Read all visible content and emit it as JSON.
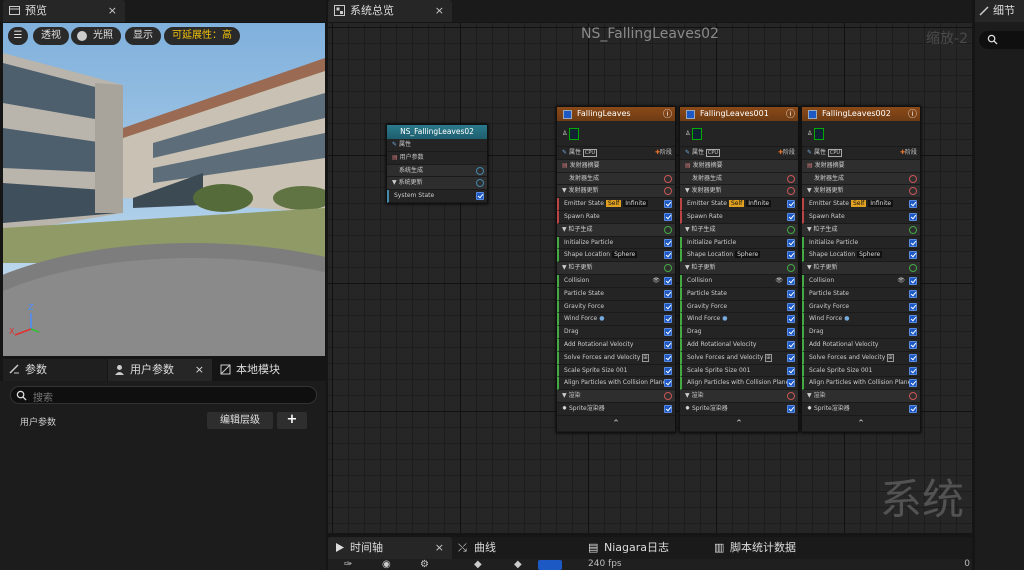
{
  "preview": {
    "tab": "预览",
    "close": "×",
    "buttons": {
      "menu": "☰",
      "perspective": "透视",
      "lighting": "光照",
      "show": "显示",
      "scalability": "可延展性：高"
    },
    "axes": {
      "z": "Z",
      "x": "X"
    }
  },
  "params_panel": {
    "tabs": [
      {
        "label": "参数"
      },
      {
        "label": "用户参数",
        "close": "×"
      },
      {
        "label": "本地模块"
      }
    ],
    "search_placeholder": "搜索",
    "row_label": "用户参数",
    "edit_hierarchy": "编辑层级",
    "add": "+"
  },
  "system_overview": {
    "tab": "系统总览",
    "close": "×",
    "title": "NS_FallingLeaves02",
    "zoom": "缩放-2",
    "watermark": "系统"
  },
  "system_node": {
    "title": "NS_FallingLeaves02",
    "rows": [
      "属性",
      "用户参数",
      "系统生成",
      "系统更新",
      "System State"
    ]
  },
  "emitters": [
    {
      "title": "FallingLeaves",
      "props": "属性",
      "cpu": "CPU",
      "stage": "阶段",
      "rows": [
        "发射器摘要",
        "发射器生成",
        "发射器更新",
        "Emitter State",
        "Spawn Rate",
        "粒子生成",
        "Initialize Particle",
        "Shape Location",
        "粒子更新",
        "Collision",
        "Particle State",
        "Gravity Force",
        "Wind Force",
        "Drag",
        "Add Rotational Velocity",
        "Solve Forces and Velocity",
        "Scale Sprite Size 001",
        "Align Particles with Collision Plane",
        "渲染",
        "Sprite渲染器"
      ],
      "self": "Self",
      "infinite": "Infinite",
      "sphere": "Sphere"
    },
    {
      "title": "FallingLeaves001",
      "props": "属性",
      "cpu": "CPU",
      "stage": "阶段",
      "rows": [
        "发射器摘要",
        "发射器生成",
        "发射器更新",
        "Emitter State",
        "Spawn Rate",
        "粒子生成",
        "Initialize Particle",
        "Shape Location",
        "粒子更新",
        "Collision",
        "Particle State",
        "Gravity Force",
        "Wind Force",
        "Drag",
        "Add Rotational Velocity",
        "Solve Forces and Velocity",
        "Scale Sprite Size 001",
        "Align Particles with Collision Plane",
        "渲染",
        "Sprite渲染器"
      ],
      "self": "Self",
      "infinite": "Infinite",
      "sphere": "Sphere"
    },
    {
      "title": "FallingLeaves002",
      "props": "属性",
      "cpu": "CPU",
      "stage": "阶段",
      "rows": [
        "发射器摘要",
        "发射器生成",
        "发射器更新",
        "Emitter State",
        "Spawn Rate",
        "粒子生成",
        "Initialize Particle",
        "Shape Location",
        "粒子更新",
        "Collision",
        "Particle State",
        "Gravity Force",
        "Wind Force",
        "Drag",
        "Add Rotational Velocity",
        "Solve Forces and Velocity",
        "Scale Sprite Size 001",
        "Align Particles with Collision Plane",
        "渲染",
        "Sprite渲染器"
      ],
      "self": "Self",
      "infinite": "Infinite",
      "sphere": "Sphere"
    }
  ],
  "details": {
    "tab": "细节"
  },
  "bottom_tabs": [
    {
      "label": "时间轴",
      "close": "×"
    },
    {
      "label": "曲线"
    },
    {
      "label": "Niagara日志"
    },
    {
      "label": "脚本统计数据"
    }
  ],
  "timeline": {
    "fps": "240 fps",
    "end": "0"
  },
  "colors": {
    "emitter_header": "#8b4a18",
    "system_header": "#1f5e6e",
    "check": "#1d59c4",
    "accent_yellow": "#f2c20a"
  }
}
